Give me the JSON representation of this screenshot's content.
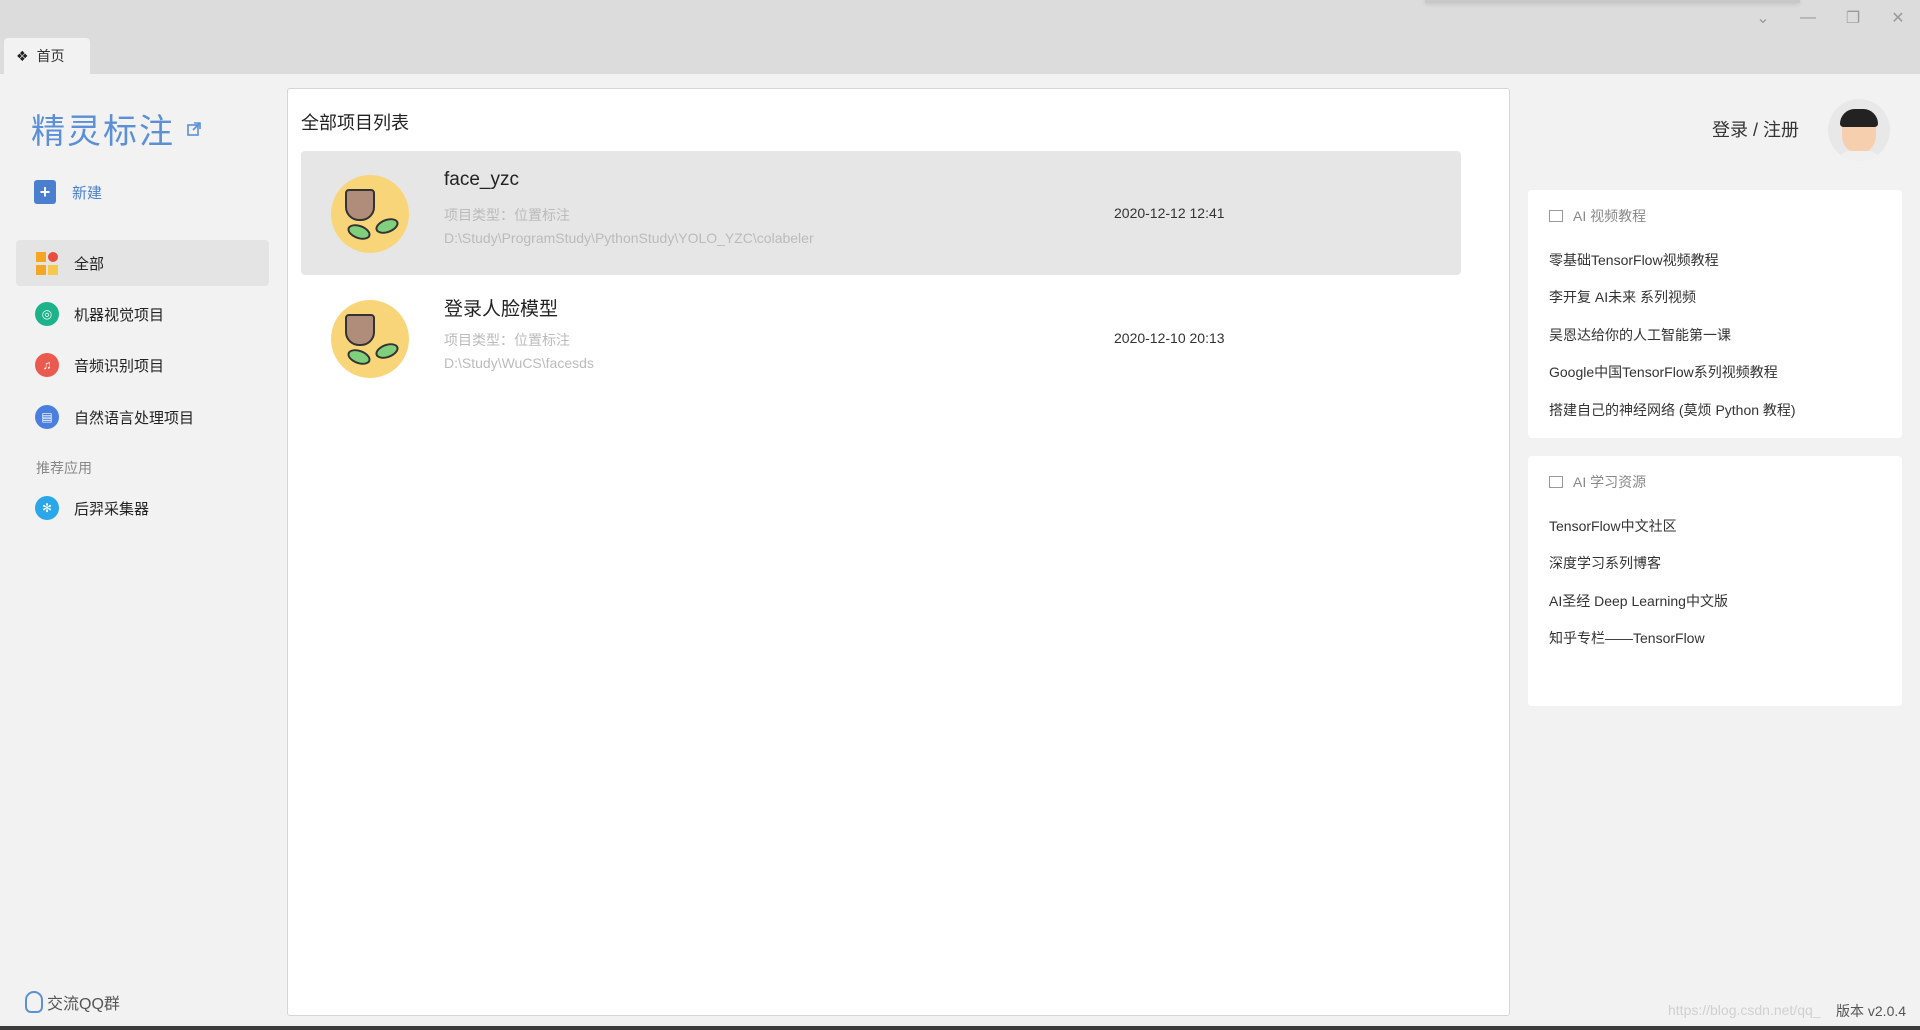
{
  "tab": {
    "label": "首页"
  },
  "sidebar": {
    "brand": "精灵标注",
    "new_label": "新建",
    "items": [
      {
        "label": "全部"
      },
      {
        "label": "机器视觉项目"
      },
      {
        "label": "音频识别项目"
      },
      {
        "label": "自然语言处理项目"
      }
    ],
    "section_label": "推荐应用",
    "apps": [
      {
        "label": "后羿采集器"
      }
    ],
    "qq_label": "交流QQ群"
  },
  "main": {
    "title": "全部项目列表",
    "projects": [
      {
        "name": "face_yzc",
        "type": "项目类型：位置标注",
        "path": "D:\\Study\\ProgramStudy\\PythonStudy\\YOLO_YZC\\colabeler",
        "date": "2020-12-12 12:41"
      },
      {
        "name": "登录人脸模型",
        "type": "项目类型：位置标注",
        "path": "D:\\Study\\WuCS\\facesds",
        "date": "2020-12-10 20:13"
      }
    ]
  },
  "right": {
    "login_label": "登录 / 注册",
    "video_card": {
      "title": "AI 视频教程",
      "links": [
        "零基础TensorFlow视频教程",
        "李开复 AI未来 系列视频",
        "吴恩达给你的人工智能第一课",
        "Google中国TensorFlow系列视频教程",
        "搭建自己的神经网络 (莫烦 Python 教程)"
      ]
    },
    "resource_card": {
      "title": "AI 学习资源",
      "links": [
        "TensorFlow中文社区",
        "深度学习系列博客",
        "AI圣经 Deep Learning中文版",
        "知乎专栏——TensorFlow"
      ]
    },
    "version": "版本 v2.0.4",
    "watermark": "https://blog.csdn.net/qq_"
  }
}
